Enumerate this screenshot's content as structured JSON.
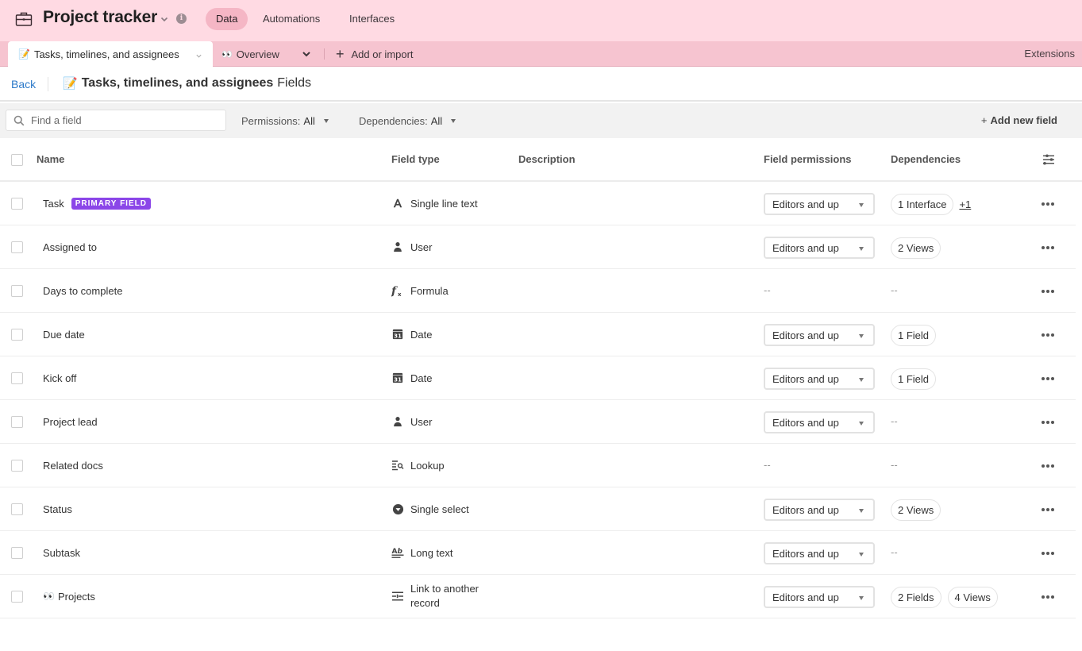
{
  "app": {
    "title": "Project tracker",
    "nav_tabs": [
      {
        "label": "Data",
        "active": true
      },
      {
        "label": "Automations",
        "active": false
      },
      {
        "label": "Interfaces",
        "active": false
      }
    ]
  },
  "table_tabs": {
    "active_tab": {
      "emoji": "📝",
      "label": "Tasks, timelines, and assignees"
    },
    "other_tab": {
      "emoji": "👀",
      "label": "Overview"
    },
    "add_import_label": "Add or import",
    "extensions_label": "Extensions"
  },
  "page_header": {
    "back_label": "Back",
    "title_emoji": "📝",
    "title_table": "Tasks, timelines, and assignees",
    "title_suffix": "Fields"
  },
  "toolbar": {
    "search_placeholder": "Find a field",
    "search_value": "",
    "permissions_label": "Permissions:",
    "permissions_value": "All",
    "dependencies_label": "Dependencies:",
    "dependencies_value": "All",
    "add_field_label": "Add new field"
  },
  "columns": {
    "name": "Name",
    "field_type": "Field type",
    "description": "Description",
    "field_permissions": "Field permissions",
    "dependencies": "Dependencies"
  },
  "colors": {
    "app_bar": "#ffdae3",
    "tab_bar": "#f6c4d0",
    "active_nav": "#f5b6c5",
    "primary_badge": "#8b46e8",
    "link": "#2d7ac9"
  },
  "rows": [
    {
      "name": "Task",
      "emoji": "",
      "badge": "PRIMARY FIELD",
      "type": "Single line text",
      "type_icon": "single-line-text-icon",
      "description": "",
      "permission": "Editors and up",
      "deps": [
        "1 Interface"
      ],
      "deps_more": "+1"
    },
    {
      "name": "Assigned to",
      "emoji": "",
      "badge": "",
      "type": "User",
      "type_icon": "user-icon",
      "description": "",
      "permission": "Editors and up",
      "deps": [
        "2 Views"
      ],
      "deps_more": ""
    },
    {
      "name": "Days to complete",
      "emoji": "",
      "badge": "",
      "type": "Formula",
      "type_icon": "formula-icon",
      "description": "",
      "permission": "--",
      "deps": [],
      "deps_empty": "--",
      "deps_more": ""
    },
    {
      "name": "Due date",
      "emoji": "",
      "badge": "",
      "type": "Date",
      "type_icon": "calendar-icon",
      "description": "",
      "permission": "Editors and up",
      "deps": [
        "1 Field"
      ],
      "deps_more": ""
    },
    {
      "name": "Kick off",
      "emoji": "",
      "badge": "",
      "type": "Date",
      "type_icon": "calendar-icon",
      "description": "",
      "permission": "Editors and up",
      "deps": [
        "1 Field"
      ],
      "deps_more": ""
    },
    {
      "name": "Project lead",
      "emoji": "",
      "badge": "",
      "type": "User",
      "type_icon": "user-icon",
      "description": "",
      "permission": "Editors and up",
      "deps": [],
      "deps_empty": "--",
      "deps_more": ""
    },
    {
      "name": "Related docs",
      "emoji": "",
      "badge": "",
      "type": "Lookup",
      "type_icon": "lookup-icon",
      "description": "",
      "permission": "--",
      "deps": [],
      "deps_empty": "--",
      "deps_more": ""
    },
    {
      "name": "Status",
      "emoji": "",
      "badge": "",
      "type": "Single select",
      "type_icon": "single-select-icon",
      "description": "",
      "permission": "Editors and up",
      "deps": [
        "2 Views"
      ],
      "deps_more": ""
    },
    {
      "name": "Subtask",
      "emoji": "",
      "badge": "",
      "type": "Long text",
      "type_icon": "long-text-icon",
      "description": "",
      "permission": "Editors and up",
      "deps": [],
      "deps_empty": "--",
      "deps_more": ""
    },
    {
      "name": "Projects",
      "emoji": "👀",
      "badge": "",
      "type": "Link to another record",
      "type_icon": "link-record-icon",
      "description": "",
      "permission": "Editors and up",
      "deps": [
        "2 Fields",
        "4 Views"
      ],
      "deps_more": ""
    }
  ]
}
